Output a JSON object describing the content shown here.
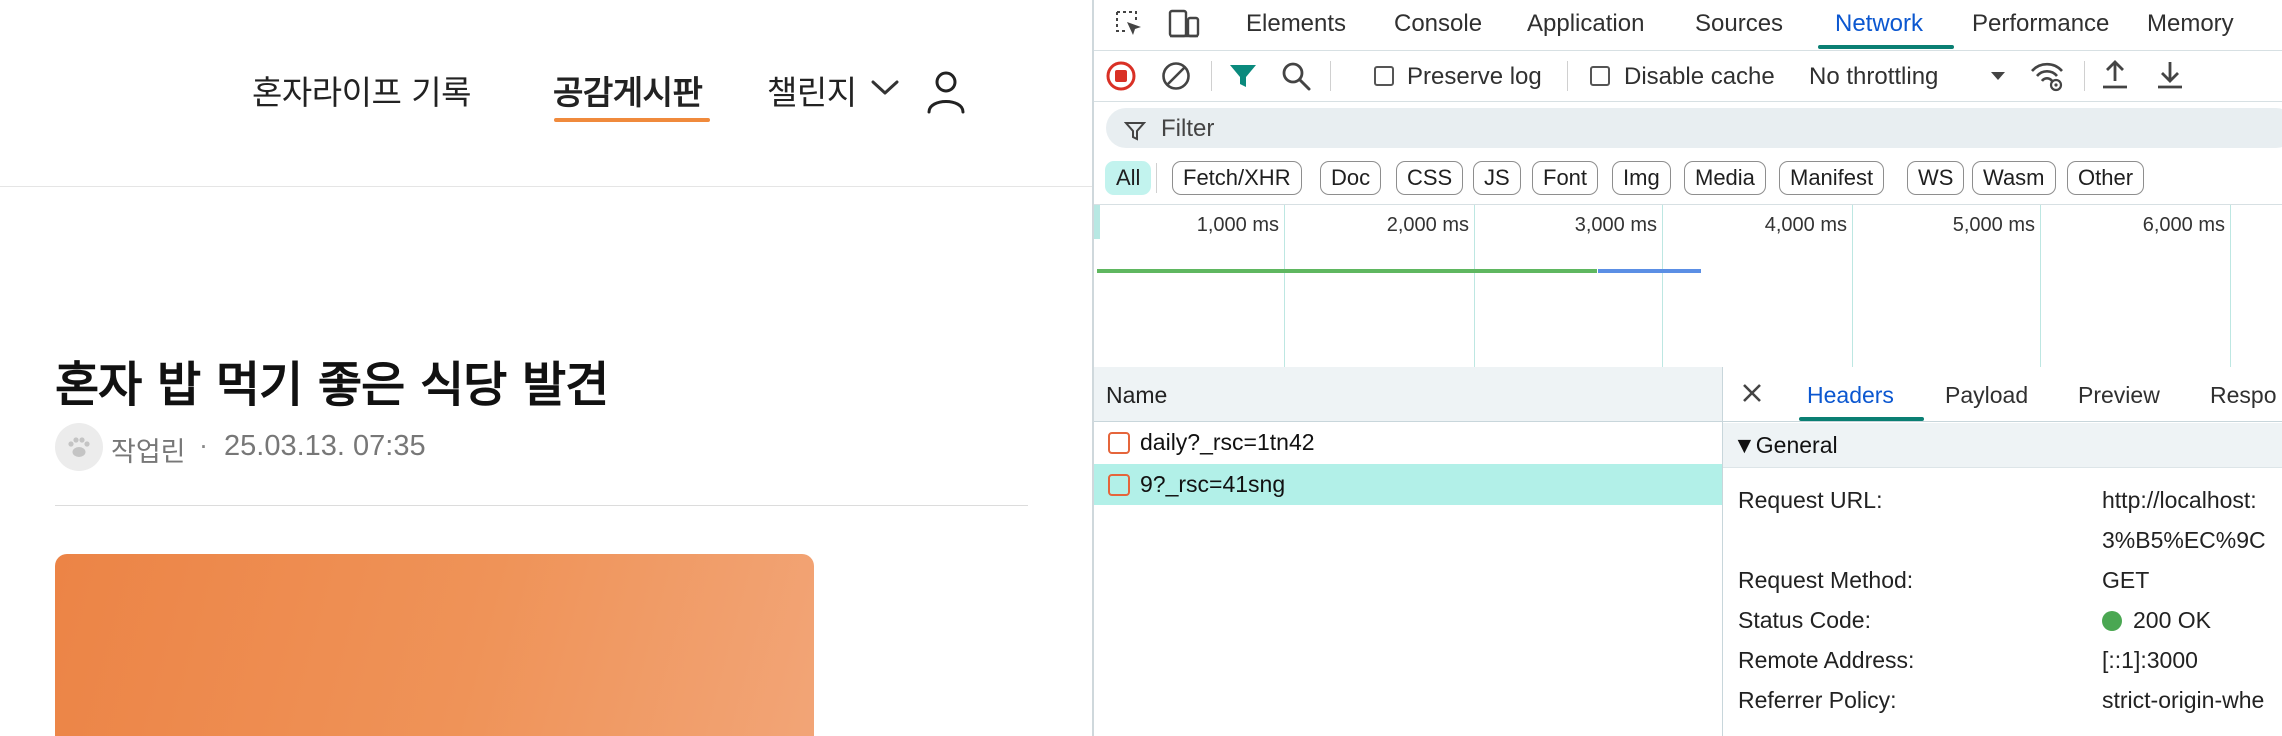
{
  "site": {
    "nav": {
      "record": "혼자라이프 기록",
      "board": "공감게시판",
      "challenge": "챌린지"
    },
    "post": {
      "title": "혼자 밥 먹기 좋은 식당 발견",
      "author": "작업린",
      "separator": "·",
      "date": "25.03.13. 07:35"
    },
    "colors": {
      "accent": "#f08a3c",
      "hero": "#ef9358"
    }
  },
  "devtools": {
    "tabs": [
      "Elements",
      "Console",
      "Application",
      "Sources",
      "Network",
      "Performance",
      "Memory"
    ],
    "active_tab": "Network",
    "toolbar": {
      "preserve_log": "Preserve log",
      "disable_cache": "Disable cache",
      "throttling": "No throttling"
    },
    "filter": {
      "placeholder": "Filter"
    },
    "type_filters": [
      "All",
      "Fetch/XHR",
      "Doc",
      "CSS",
      "JS",
      "Font",
      "Img",
      "Media",
      "Manifest",
      "WS",
      "Wasm",
      "Other"
    ],
    "timeline": {
      "ticks": [
        "1,000 ms",
        "2,000 ms",
        "3,000 ms",
        "4,000 ms",
        "5,000 ms",
        "6,000 ms"
      ],
      "colors": {
        "waiting": "#5fb760",
        "download": "#5b8fe5",
        "grid": "#bde7e2"
      }
    },
    "request_list": {
      "column": "Name",
      "rows": [
        "daily?_rsc=1tn42",
        "9?_rsc=41sng"
      ],
      "selected": "9?_rsc=41sng"
    },
    "details": {
      "tabs": [
        "Headers",
        "Payload",
        "Preview",
        "Respo"
      ],
      "active_tab": "Headers",
      "section": "▼General",
      "fields": {
        "request_url": {
          "label": "Request URL:",
          "value_line1": "http://localhost:",
          "value_line2": "3%B5%EC%9C"
        },
        "request_method": {
          "label": "Request Method:",
          "value": "GET"
        },
        "status_code": {
          "label": "Status Code:",
          "value": "200 OK"
        },
        "remote_address": {
          "label": "Remote Address:",
          "value": "[::1]:3000"
        },
        "referrer_policy": {
          "label": "Referrer Policy:",
          "value": "strict-origin-whe"
        }
      }
    }
  }
}
